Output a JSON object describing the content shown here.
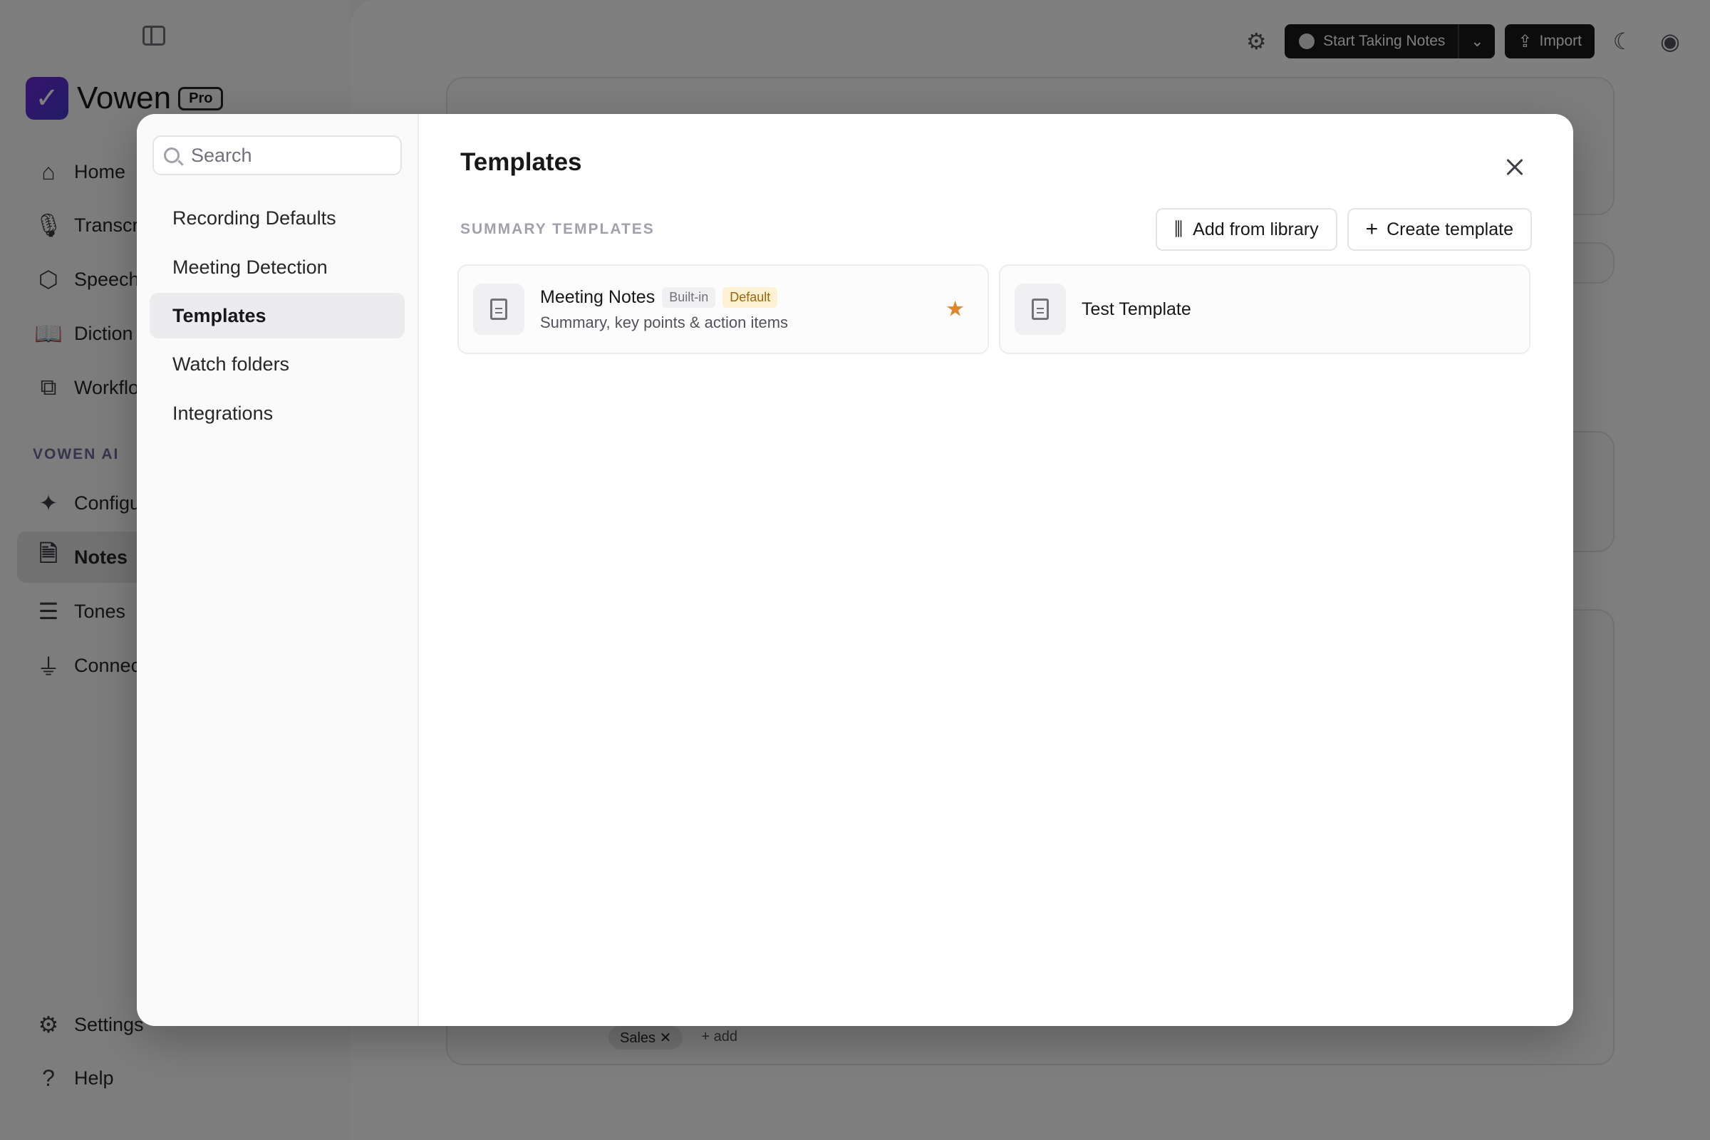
{
  "app": {
    "name": "Vowen",
    "plan_badge": "Pro"
  },
  "sidebar": {
    "items": [
      {
        "label": "Home"
      },
      {
        "label": "Transcri"
      },
      {
        "label": "Speech"
      },
      {
        "label": "Diction"
      },
      {
        "label": "Workflo"
      }
    ],
    "section_label": "VOWEN AI",
    "ai_items": [
      {
        "label": "Configu"
      },
      {
        "label": "Notes"
      },
      {
        "label": "Tones"
      },
      {
        "label": "Connec"
      }
    ],
    "footer_items": [
      {
        "label": "Settings"
      },
      {
        "label": "Help"
      }
    ]
  },
  "topbar": {
    "start_label": "Start Taking Notes",
    "import_label": "Import"
  },
  "background": {
    "tags": [
      {
        "label": "Sales"
      }
    ],
    "add_tag_label": "+ add"
  },
  "modal": {
    "search_placeholder": "Search",
    "nav": [
      {
        "label": "Recording Defaults"
      },
      {
        "label": "Meeting Detection"
      },
      {
        "label": "Templates"
      },
      {
        "label": "Watch folders"
      },
      {
        "label": "Integrations"
      }
    ],
    "title": "Templates",
    "section_title": "SUMMARY TEMPLATES",
    "add_from_library_label": "Add from library",
    "create_template_label": "Create template",
    "templates": [
      {
        "name": "Meeting Notes",
        "builtin_badge": "Built-in",
        "default_badge": "Default",
        "description": "Summary, key points & action items"
      },
      {
        "name": "Test Template"
      }
    ]
  },
  "colors": {
    "accent_star": "#e0872b",
    "default_badge_bg": "#fdf2d4",
    "logo": "#5b21b6"
  }
}
